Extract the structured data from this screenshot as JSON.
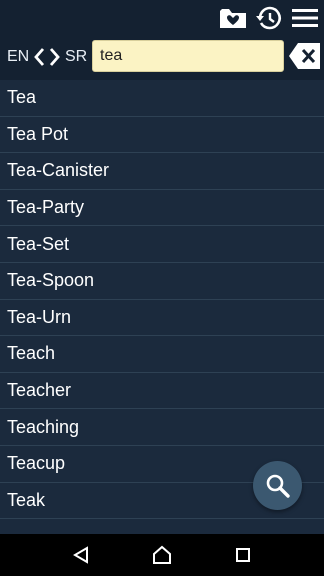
{
  "header": {
    "icons": [
      "favorites-folder-icon",
      "history-icon",
      "menu-icon"
    ]
  },
  "language": {
    "from": "EN",
    "to": "SR",
    "swap_icon": "swap-arrows-icon"
  },
  "search": {
    "value": "tea",
    "clear_icon": "backspace-clear-icon"
  },
  "results": [
    "Tea",
    "Tea Pot",
    "Tea-Canister",
    "Tea-Party",
    "Tea-Set",
    "Tea-Spoon",
    "Tea-Urn",
    "Teach",
    "Teacher",
    "Teaching",
    "Teacup",
    "Teak"
  ],
  "fab_icon": "search-icon",
  "nav": [
    "back-icon",
    "home-icon",
    "recents-icon"
  ],
  "colors": {
    "background": "#1b2a3d",
    "bar": "#142131",
    "search_field": "#fbf3c4",
    "divider": "#2e4154",
    "fab": "#3b5870"
  }
}
